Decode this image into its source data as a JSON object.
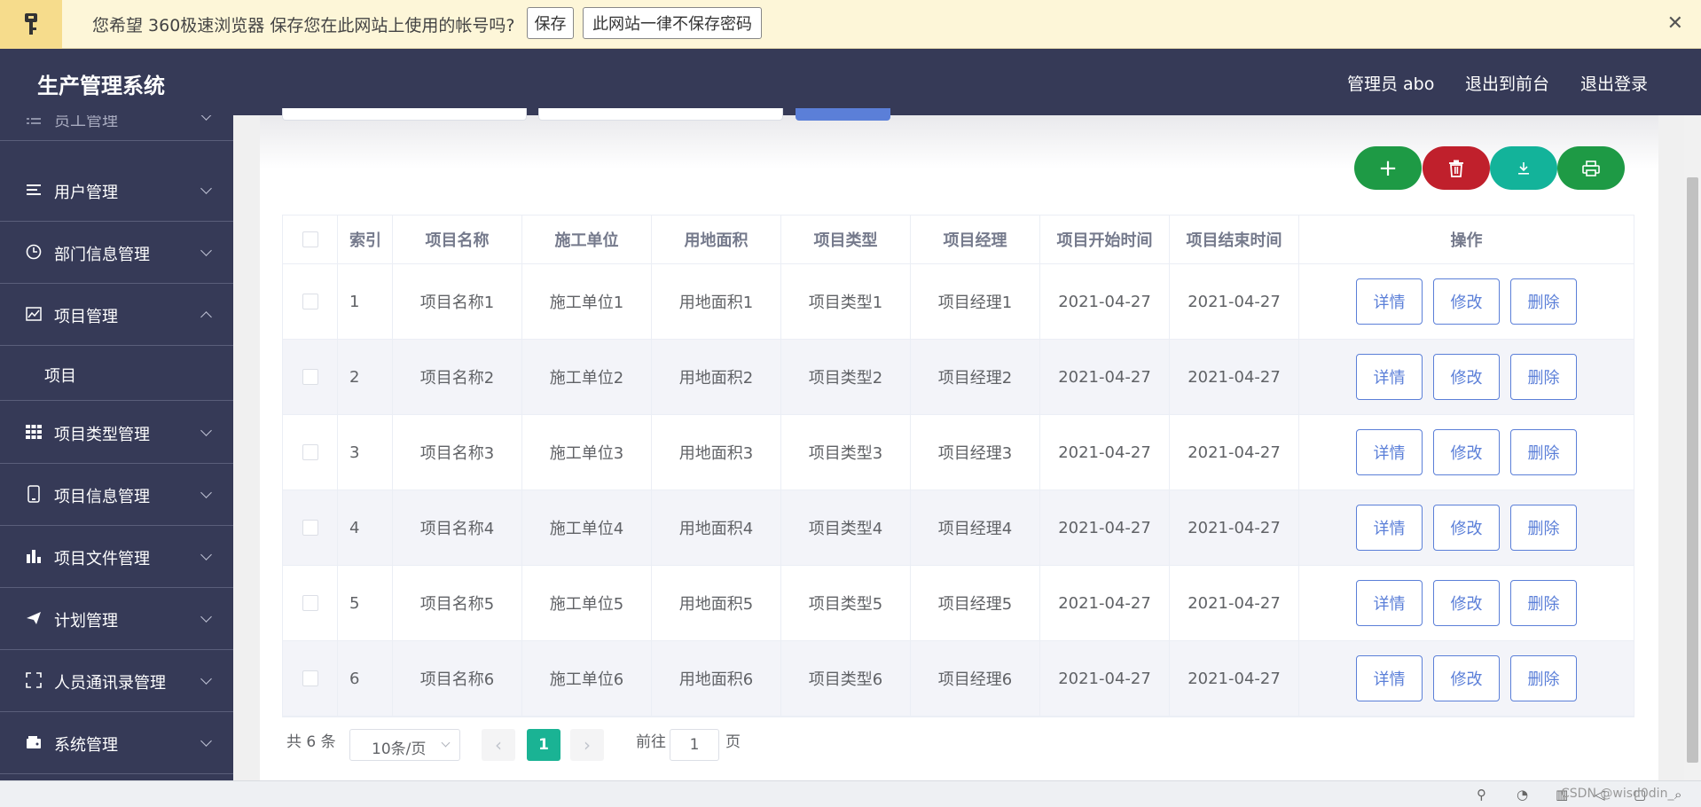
{
  "password_bar": {
    "message": "您希望 360极速浏览器 保存您在此网站上使用的帐号吗?",
    "save_label": "保存",
    "never_label": "此网站一律不保存密码",
    "close_glyph": "✕"
  },
  "header": {
    "title": "生产管理系统",
    "user": "管理员 abo",
    "front_label": "退出到前台",
    "logout_label": "退出登录"
  },
  "sidebar": {
    "items": [
      {
        "label": "员工管理",
        "icon": "list-icon"
      },
      {
        "label": "用户管理",
        "icon": "menu-icon"
      },
      {
        "label": "部门信息管理",
        "icon": "clock-icon"
      },
      {
        "label": "项目管理",
        "icon": "chart-icon"
      },
      {
        "label": "项目类型管理",
        "icon": "grid-icon"
      },
      {
        "label": "项目信息管理",
        "icon": "phone-icon"
      },
      {
        "label": "项目文件管理",
        "icon": "bar-chart-icon"
      },
      {
        "label": "计划管理",
        "icon": "send-icon"
      },
      {
        "label": "人员通讯录管理",
        "icon": "fullscreen-icon"
      },
      {
        "label": "系统管理",
        "icon": "wallet-icon"
      }
    ],
    "submenu": "项目"
  },
  "toolbar": {
    "add_glyph": "+",
    "colors": {
      "add": "#1e9a45",
      "delete": "#c0202c",
      "download": "#13b39a",
      "print": "#1e9a45"
    }
  },
  "table": {
    "headers": [
      "索引",
      "项目名称",
      "施工单位",
      "用地面积",
      "项目类型",
      "项目经理",
      "项目开始时间",
      "项目结束时间",
      "操作"
    ],
    "rows": [
      {
        "idx": "1",
        "name": "项目名称1",
        "unit": "施工单位1",
        "area": "用地面积1",
        "type": "项目类型1",
        "manager": "项目经理1",
        "start": "2021-04-27",
        "end": "2021-04-27"
      },
      {
        "idx": "2",
        "name": "项目名称2",
        "unit": "施工单位2",
        "area": "用地面积2",
        "type": "项目类型2",
        "manager": "项目经理2",
        "start": "2021-04-27",
        "end": "2021-04-27"
      },
      {
        "idx": "3",
        "name": "项目名称3",
        "unit": "施工单位3",
        "area": "用地面积3",
        "type": "项目类型3",
        "manager": "项目经理3",
        "start": "2021-04-27",
        "end": "2021-04-27"
      },
      {
        "idx": "4",
        "name": "项目名称4",
        "unit": "施工单位4",
        "area": "用地面积4",
        "type": "项目类型4",
        "manager": "项目经理4",
        "start": "2021-04-27",
        "end": "2021-04-27"
      },
      {
        "idx": "5",
        "name": "项目名称5",
        "unit": "施工单位5",
        "area": "用地面积5",
        "type": "项目类型5",
        "manager": "项目经理5",
        "start": "2021-04-27",
        "end": "2021-04-27"
      },
      {
        "idx": "6",
        "name": "项目名称6",
        "unit": "施工单位6",
        "area": "用地面积6",
        "type": "项目类型6",
        "manager": "项目经理6",
        "start": "2021-04-27",
        "end": "2021-04-27"
      }
    ],
    "actions": {
      "detail": "详情",
      "edit": "修改",
      "delete": "删除"
    }
  },
  "pagination": {
    "total": "共 6 条",
    "page_size": "10条/页",
    "current": "1",
    "goto_prefix": "前往",
    "goto_value": "1",
    "goto_suffix": "页"
  },
  "statusbar": {
    "watermark": "CSDN @wisd0din_"
  }
}
